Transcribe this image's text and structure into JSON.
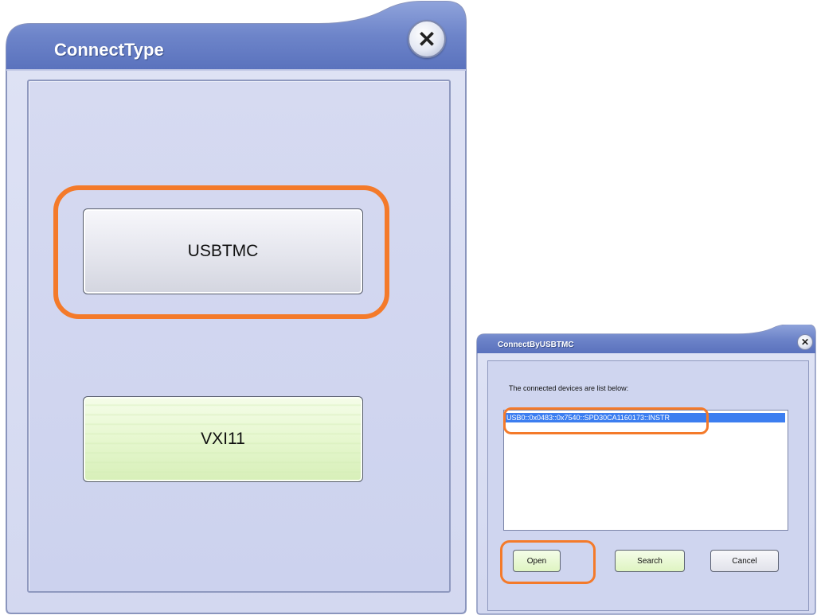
{
  "connect_type_dialog": {
    "title": "ConnectType",
    "close_symbol": "✕",
    "usbtmc_label": "USBTMC",
    "vxi11_label": "VXI11",
    "highlight_color": "#f47a2a"
  },
  "usbtmc_dialog": {
    "title": "ConnectByUSBTMC",
    "close_symbol": "✕",
    "list_label": "The connected devices are list below:",
    "devices": [
      "USB0::0x0483::0x7540::SPD30CA1160173::INSTR"
    ],
    "open_label": "Open",
    "search_label": "Search",
    "cancel_label": "Cancel",
    "selection_color": "#3c7ef0"
  }
}
